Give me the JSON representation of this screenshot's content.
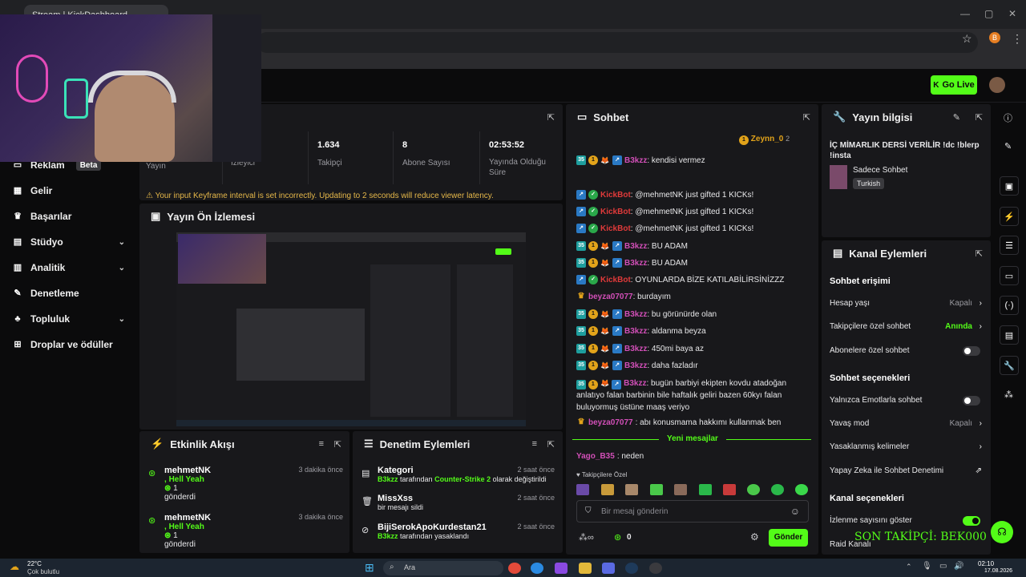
{
  "browser": {
    "tab_title": "Stream | KickDashboard",
    "profile_letter": "B"
  },
  "header": {
    "go_live": "Go Live"
  },
  "sidebar": {
    "items": [
      {
        "label": "Reklam",
        "badge": "Beta",
        "icon": "ad-icon"
      },
      {
        "label": "Gelir",
        "icon": "revenue-icon"
      },
      {
        "label": "Başarılar",
        "icon": "trophy-icon"
      },
      {
        "label": "Stüdyo",
        "icon": "studio-icon",
        "expand": true
      },
      {
        "label": "Analitik",
        "icon": "analytics-icon",
        "expand": true
      },
      {
        "label": "Denetleme",
        "icon": "moderation-icon"
      },
      {
        "label": "Topluluk",
        "icon": "community-icon",
        "expand": true
      },
      {
        "label": "Droplar ve ödüller",
        "icon": "drops-icon"
      }
    ]
  },
  "stats": {
    "items": [
      {
        "value": "",
        "label": "Yayın"
      },
      {
        "value": "",
        "label": "İzleyici"
      },
      {
        "value": "1.634",
        "label": "Takipçi"
      },
      {
        "value": "8",
        "label": "Abone Sayısı"
      },
      {
        "value": "02:53:52",
        "label": "Yayında Olduğu Süre"
      }
    ],
    "warning": "Your input Keyframe interval is set incorrectly. Updating to 2 seconds will reduce viewer latency."
  },
  "preview": {
    "title": "Yayın Ön İzlemesi"
  },
  "activity": {
    "title": "Etkinlik Akışı",
    "items": [
      {
        "name": "mehmetNK",
        "reward": "Hell Yeah",
        "count": "1",
        "action": "gönderdi",
        "time": "3 dakika önce"
      },
      {
        "name": "mehmetNK",
        "reward": "Hell Yeah",
        "count": "1",
        "action": "gönderdi",
        "time": "3 dakika önce"
      }
    ]
  },
  "moderation": {
    "title": "Denetim Eylemleri",
    "items": [
      {
        "title": "Kategori",
        "time": "2 saat önce",
        "actor": "B3kzz",
        "mid": "tarafından",
        "target": "Counter-Strike 2",
        "tail": "olarak değiştirildi",
        "icon": "category-icon"
      },
      {
        "title": "MissXss",
        "time": "2 saat önce",
        "actor": "",
        "mid": "bir mesajı sildi",
        "target": "",
        "tail": "",
        "icon": "trash-icon"
      },
      {
        "title": "BijiSerokApoKurdestan21",
        "time": "2 saat önce",
        "actor": "B3kzz",
        "mid": "tarafından yasaklandı",
        "target": "",
        "tail": "",
        "icon": "ban-icon"
      }
    ]
  },
  "chat": {
    "title": "Sohbet",
    "pinned_user": "Zeynn_0",
    "pinned_count": "2",
    "messages": [
      {
        "badges": [
          "35",
          "1",
          "fox",
          "arr"
        ],
        "user": "B3kzz",
        "style": "pink",
        "text": ": kendisi vermez"
      },
      {
        "badges": [
          "arr",
          "chk"
        ],
        "user": "KickBot",
        "style": "red",
        "text": ": @mehmetNK just gifted 1 KICKs!"
      },
      {
        "badges": [
          "arr",
          "chk"
        ],
        "user": "KickBot",
        "style": "red",
        "text": ": @mehmetNK just gifted 1 KICKs!"
      },
      {
        "badges": [
          "arr",
          "chk"
        ],
        "user": "KickBot",
        "style": "red",
        "text": ": @mehmetNK just gifted 1 KICKs!"
      },
      {
        "badges": [
          "35",
          "1",
          "fox",
          "arr"
        ],
        "user": "B3kzz",
        "style": "pink",
        "text": ": BU ADAM"
      },
      {
        "badges": [
          "35",
          "1",
          "fox",
          "arr"
        ],
        "user": "B3kzz",
        "style": "pink",
        "text": ": BU ADAM"
      },
      {
        "badges": [
          "arr",
          "chk"
        ],
        "user": "KickBot",
        "style": "red",
        "text": ": OYUNLARDA BİZE KATILABİLİRSİNİZZZ"
      },
      {
        "badges": [
          "crown"
        ],
        "user": "beyza07077",
        "style": "beyza",
        "text": ": burdayım"
      },
      {
        "badges": [
          "35",
          "1",
          "fox",
          "arr"
        ],
        "user": "B3kzz",
        "style": "pink",
        "text": ": bu görünürde olan"
      },
      {
        "badges": [
          "35",
          "1",
          "fox",
          "arr"
        ],
        "user": "B3kzz",
        "style": "pink",
        "text": ": aldanma beyza"
      },
      {
        "badges": [
          "35",
          "1",
          "fox",
          "arr"
        ],
        "user": "B3kzz",
        "style": "pink",
        "text": ": 450mi baya az"
      },
      {
        "badges": [
          "35",
          "1",
          "fox",
          "arr"
        ],
        "user": "B3kzz",
        "style": "pink",
        "text": ": daha fazladır"
      }
    ],
    "long_message": {
      "user": "B3kzz",
      "line1": ": bugün barbiyi ekipten kovdu atadoğan",
      "line2": "anlatıyo falan barbinin bile haftalık geliri bazen 60kyı falan",
      "line3": "buluyormuş üstüne maaş veriyo"
    },
    "last_message": {
      "user": "beyza07077",
      "text": ": abı konusmama hakkımı kullanmak ben"
    },
    "new_messages": "Yeni mesajlar",
    "after_new": {
      "user": "Yago_B35",
      "text": ": neden"
    },
    "followers_only": "Takipçilere Özel",
    "input_placeholder": "Bir mesaj gönderin",
    "points": "0",
    "send": "Gönder"
  },
  "stream_info": {
    "title": "Yayın bilgisi",
    "stream_title": "İÇ MİMARLIK DERSİ VERİLİR !dc !blerp !insta",
    "category": "Sadece Sohbet",
    "language": "Turkish"
  },
  "channel_actions": {
    "title": "Kanal Eylemleri",
    "chat_access": "Sohbet erişimi",
    "rows1": [
      {
        "label": "Hesap yaşı",
        "right": "Kapalı",
        "kind": "chevron"
      },
      {
        "label": "Takipçilere özel sohbet",
        "right": "Anında",
        "kind": "chevron-green"
      },
      {
        "label": "Abonelere özel sohbet",
        "right": "",
        "kind": "toggle-off"
      }
    ],
    "chat_options": "Sohbet seçenekleri",
    "rows2": [
      {
        "label": "Yalnızca Emotlarla sohbet",
        "right": "",
        "kind": "toggle-off"
      },
      {
        "label": "Yavaş mod",
        "right": "Kapalı",
        "kind": "chevron"
      },
      {
        "label": "Yasaklanmış kelimeler",
        "right": "",
        "kind": "chevron"
      },
      {
        "label": "Yapay Zeka ile Sohbet Denetimi",
        "right": "",
        "kind": "external"
      }
    ],
    "channel_options": "Kanal seçenekleri",
    "rows3": [
      {
        "label": "İzlenme sayısını göster",
        "right": "",
        "kind": "toggle-on"
      },
      {
        "label": "Raid Kanalı",
        "right": "",
        "kind": ""
      }
    ]
  },
  "overlay_text": "SON TAKİPÇİ: BEK000",
  "taskbar": {
    "weather_temp": "22°C",
    "weather_desc": "Çok bulutlu",
    "search": "Ara",
    "time": "02:10",
    "date": "17.08.2026"
  }
}
